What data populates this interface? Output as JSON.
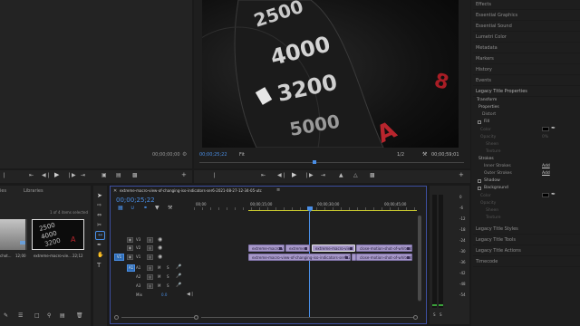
{
  "source_monitor": {
    "timecode_right": "00;00;00;00"
  },
  "program_monitor": {
    "timecode_left": "00;00;25;22",
    "fit_label": "Fit",
    "quality": "1/2",
    "timecode_right": "00;00;59;01",
    "image_text": {
      "n1": "4000",
      "n2": "3200",
      "n3": "5000",
      "n4": "2500"
    }
  },
  "project_panel": {
    "tabs": [
      "ies",
      "Libraries"
    ],
    "items_selected": "1 of 4 items selected",
    "clip_left": {
      "name": "chot...",
      "duration": "12;00"
    },
    "clip_right": {
      "name": "extreme-macro-vie...",
      "duration": "22;12"
    }
  },
  "timeline": {
    "sequence_tab": "extreme-macro-view-of-changing-iso-indicators-ser6-2021-08-27-12-34-05-utc",
    "timecode": "00;00;25;22",
    "ruler": [
      "00;00",
      "00;00;15;00",
      "00;00;30;00",
      "00;00;45;00"
    ],
    "video_tracks": [
      {
        "label": "V3"
      },
      {
        "label": "V2"
      },
      {
        "label": "V1",
        "source_patch": "V1"
      }
    ],
    "audio_tracks": [
      {
        "label": "A1",
        "source_patch": "A1"
      },
      {
        "label": "A2"
      },
      {
        "label": "A3"
      }
    ],
    "mix_label": "Mix",
    "mix_value": "0.0",
    "track_buttons": {
      "m": "M",
      "s": "S"
    },
    "v2_clips": [
      "extreme-macro-v",
      "extreme",
      "extreme-macro-view",
      "close-motion-shot-of-white-d"
    ],
    "v1_clips": [
      "extreme-macro-view-of-changing-iso-indicators-ser6-2021-08-27",
      "extreme-macro-v",
      "close-motion-shot-of-white-d"
    ]
  },
  "meters": {
    "scale": [
      "0",
      "-6",
      "-12",
      "-18",
      "-24",
      "-30",
      "-36",
      "-42",
      "-48",
      "-54"
    ],
    "bottom": [
      "S",
      "S"
    ]
  },
  "right_panel": {
    "items": [
      "Effects",
      "Essential Graphics",
      "Essential Sound",
      "Lumetri Color",
      "Metadata",
      "Markers",
      "History",
      "Events",
      "Legacy Title Properties"
    ],
    "props": {
      "transform": "Transform",
      "properties": "Properties",
      "distort": "Distort",
      "fill": "Fill",
      "fill_color": "Color",
      "opacity": "Opacity",
      "sheen": "Sheen",
      "texture": "Texture",
      "strokes": "Strokes",
      "inner": "Inner Strokes",
      "outer": "Outer Strokes",
      "add1": "Add",
      "add2": "Add",
      "shadow": "Shadow",
      "background": "Background",
      "bg_color": "Color",
      "bg_opacity": "Opacity",
      "bg_sheen": "Sheen",
      "bg_texture": "Texture",
      "pct": "0%"
    },
    "bottom_items": [
      "Legacy Title Styles",
      "Legacy Title Tools",
      "Legacy Title Actions",
      "Timecode"
    ]
  }
}
